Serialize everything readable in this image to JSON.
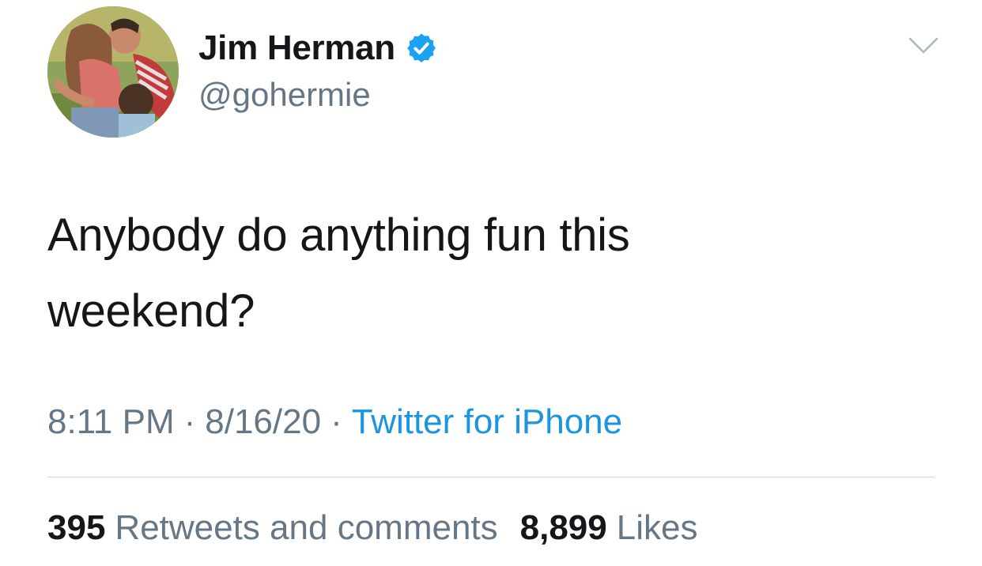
{
  "tweet": {
    "author": {
      "display_name": "Jim Herman",
      "handle": "@gohermie",
      "verified": true,
      "verified_icon": "verified-badge-icon",
      "verified_color": "#1da1f2"
    },
    "text_line_1": "Anybody do anything fun this",
    "text_line_2": "weekend?",
    "time": "8:11 PM",
    "date": "8/16/20",
    "separator": "·",
    "source": "Twitter for iPhone",
    "stats": {
      "retweets_count": "395",
      "retweets_label": "Retweets and comments",
      "likes_count": "8,899",
      "likes_label": "Likes"
    },
    "menu_icon": "chevron-down-icon"
  },
  "colors": {
    "text_primary": "#14171a",
    "text_secondary": "#657786",
    "link": "#1b95e0",
    "divider": "#d4d7da"
  }
}
